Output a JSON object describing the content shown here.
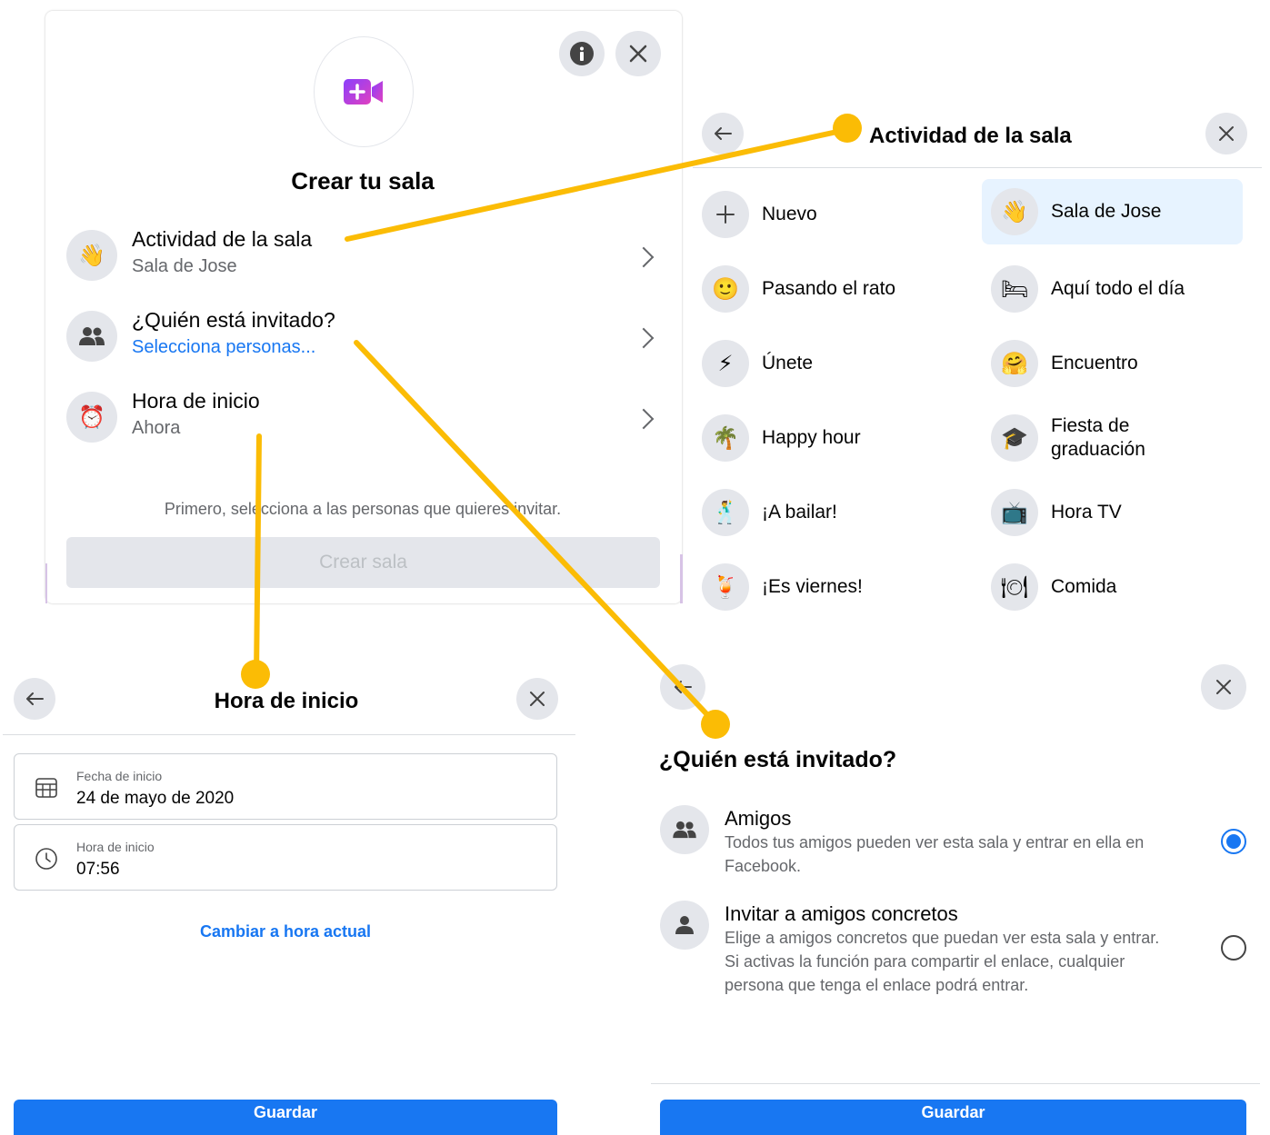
{
  "create_room": {
    "title": "Crear tu sala",
    "rows": [
      {
        "title": "Actividad de la sala",
        "subtitle": "Sala de Jose",
        "icon": "waving-hand-icon"
      },
      {
        "title": "¿Quién está invitado?",
        "subtitle": "Selecciona personas...",
        "icon": "people-icon"
      },
      {
        "title": "Hora de inicio",
        "subtitle": "Ahora",
        "icon": "alarm-clock-icon"
      }
    ],
    "hint": "Primero, selecciona a las personas que quieres invitar.",
    "create_button": "Crear sala"
  },
  "activity": {
    "title": "Actividad de la sala",
    "items": [
      {
        "label": "Nuevo",
        "icon": "plus-icon"
      },
      {
        "label": "Sala de Jose",
        "icon": "waving-hand-icon",
        "selected": true
      },
      {
        "label": "Pasando el rato",
        "icon": "smiley-icon"
      },
      {
        "label": "Aquí todo el día",
        "icon": "bed-icon"
      },
      {
        "label": "Únete",
        "icon": "lightning-icon"
      },
      {
        "label": "Encuentro",
        "icon": "hugging-face-icon"
      },
      {
        "label": "Happy hour",
        "icon": "palm-tree-icon"
      },
      {
        "label": "Fiesta de graduación",
        "icon": "graduation-cap-icon"
      },
      {
        "label": "¡A bailar!",
        "icon": "dancer-icon"
      },
      {
        "label": "Hora TV",
        "icon": "tv-icon"
      },
      {
        "label": "¡Es viernes!",
        "icon": "tropical-drink-icon"
      },
      {
        "label": "Comida",
        "icon": "plate-icon"
      }
    ]
  },
  "start_time": {
    "title": "Hora de inicio",
    "date_label": "Fecha de inicio",
    "date_value": "24 de mayo de 2020",
    "time_label": "Hora de inicio",
    "time_value": "07:56",
    "reset_link": "Cambiar a hora actual",
    "save_button": "Guardar"
  },
  "invited": {
    "title": "¿Quién está invitado?",
    "options": [
      {
        "title": "Amigos",
        "description": "Todos tus amigos pueden ver esta sala y entrar en ella en Facebook.",
        "selected": true
      },
      {
        "title": "Invitar a amigos concretos",
        "description": "Elige a amigos concretos que puedan ver esta sala y entrar. Si activas la función para compartir el enlace, cualquier persona que tenga el enlace podrá entrar.",
        "selected": false
      }
    ],
    "save_button": "Guardar"
  },
  "colors": {
    "accent": "#1877f2",
    "annotation": "#fbbc05",
    "selected_bg": "#e7f3ff",
    "icon_bg": "#e4e6eb"
  }
}
